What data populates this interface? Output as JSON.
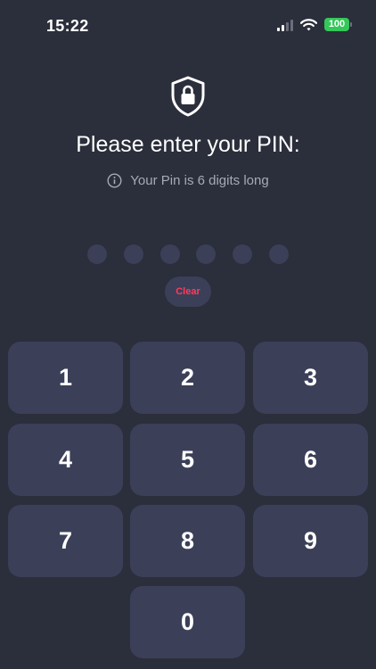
{
  "status_bar": {
    "time": "15:22",
    "battery": "100",
    "icons": [
      "signal-icon",
      "wifi-icon",
      "battery-icon"
    ]
  },
  "pin": {
    "title": "Please enter your PIN:",
    "hint": "Your Pin is 6 digits long",
    "length": 6,
    "entered": 0,
    "clear_label": "Clear"
  },
  "keypad": {
    "keys": [
      "1",
      "2",
      "3",
      "4",
      "5",
      "6",
      "7",
      "8",
      "9",
      "0"
    ]
  },
  "colors": {
    "background": "#2b2e3b",
    "key": "#3b3f58",
    "clear_text": "#ff3b5c",
    "battery": "#34c759"
  }
}
